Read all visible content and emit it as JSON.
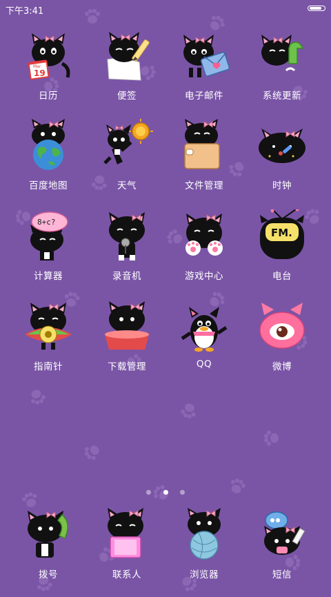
{
  "status_bar": {
    "time": "下午3:41",
    "battery_level": 0.9
  },
  "home": {
    "apps": [
      {
        "label": "日历",
        "icon": "calendar-cat-icon",
        "calendar_text": "Mar",
        "calendar_day": "19"
      },
      {
        "label": "便签",
        "icon": "notes-cat-icon"
      },
      {
        "label": "电子邮件",
        "icon": "email-cat-icon"
      },
      {
        "label": "系统更新",
        "icon": "system-update-cat-icon"
      },
      {
        "label": "百度地图",
        "icon": "map-globe-cat-icon"
      },
      {
        "label": "天气",
        "icon": "weather-sun-cat-icon"
      },
      {
        "label": "文件管理",
        "icon": "file-box-cat-icon"
      },
      {
        "label": "时钟",
        "icon": "clock-cat-icon"
      },
      {
        "label": "计算器",
        "icon": "calculator-cat-icon",
        "bubble_text": "8+c?"
      },
      {
        "label": "录音机",
        "icon": "recorder-mic-cat-icon"
      },
      {
        "label": "游戏中心",
        "icon": "game-center-paws-cat-icon"
      },
      {
        "label": "电台",
        "icon": "radio-fm-icon",
        "radio_text": "FM."
      },
      {
        "label": "指南针",
        "icon": "compass-cat-icon"
      },
      {
        "label": "下载管理",
        "icon": "download-bowl-cat-icon"
      },
      {
        "label": "QQ",
        "icon": "qq-penguin-icon"
      },
      {
        "label": "微博",
        "icon": "weibo-eye-icon"
      }
    ],
    "pages": {
      "count": 3,
      "current": 2
    }
  },
  "dock": {
    "apps": [
      {
        "label": "拨号",
        "icon": "phone-dialer-cat-icon"
      },
      {
        "label": "联系人",
        "icon": "contacts-book-cat-icon"
      },
      {
        "label": "浏览器",
        "icon": "browser-yarn-cat-icon"
      },
      {
        "label": "短信",
        "icon": "messages-bubble-cat-icon"
      }
    ]
  },
  "colors": {
    "background": "#7a55a6",
    "cat_black": "#111111",
    "bow_pink": "#f7a8c8",
    "label_white": "#ffffff"
  }
}
